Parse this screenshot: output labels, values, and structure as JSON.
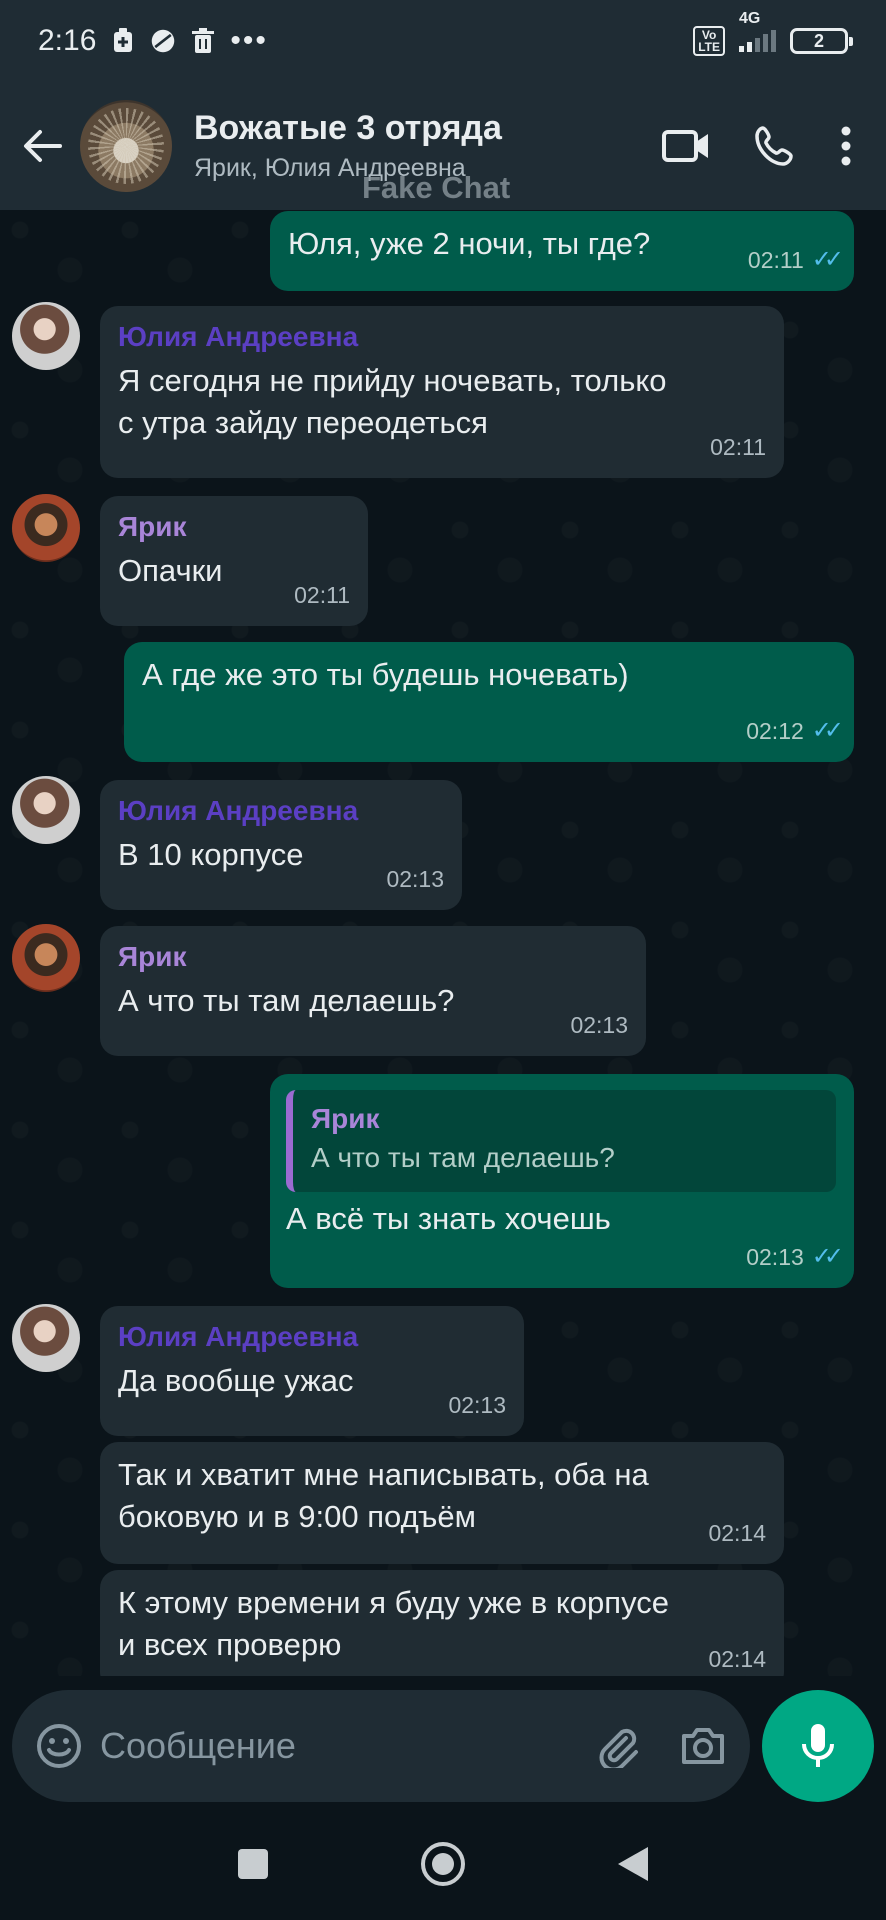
{
  "status_bar": {
    "time": "2:16",
    "network": "4G",
    "volte": "Vo LTE",
    "battery": "2"
  },
  "header": {
    "title": "Вожатые 3 отряда",
    "subtitle": "Ярик, Юлия Андреевна",
    "watermark": "Fake Chat"
  },
  "messages": [
    {
      "direction": "out",
      "text": "Юля, уже 2 ночи, ты где?",
      "time": "02:11",
      "read": true
    },
    {
      "direction": "in",
      "sender": "Юлия Андреевна",
      "text": "Я сегодня не прийду ночевать, только с утра зайду переодеться",
      "time": "02:11"
    },
    {
      "direction": "in",
      "sender": "Ярик",
      "text": "Опачки",
      "time": "02:11"
    },
    {
      "direction": "out",
      "text": "А где же это ты будешь ночевать)",
      "time": "02:12",
      "read": true
    },
    {
      "direction": "in",
      "sender": "Юлия Андреевна",
      "text": "В 10 корпусе",
      "time": "02:13"
    },
    {
      "direction": "in",
      "sender": "Ярик",
      "text": "А что ты там делаешь?",
      "time": "02:13"
    },
    {
      "direction": "out",
      "quote_author": "Ярик",
      "quote_text": "А что ты там делаешь?",
      "text": "А всё ты знать хочешь",
      "time": "02:13",
      "read": true
    },
    {
      "direction": "in",
      "sender": "Юлия Андреевна",
      "text": "Да вообще ужас",
      "time": "02:13"
    },
    {
      "direction": "in",
      "text": "Так и хватит мне написывать, оба на боковую и в 9:00 подъём",
      "time": "02:14"
    },
    {
      "direction": "in",
      "text": "К этому времени я буду уже в корпусе и всех проверю",
      "time": "02:14"
    }
  ],
  "composer": {
    "placeholder": "Сообщение"
  },
  "colors": {
    "outgoing_bubble": "#005c4b",
    "incoming_bubble": "#202c33",
    "accent": "#00a884",
    "read_ticks": "#53bdeb"
  }
}
